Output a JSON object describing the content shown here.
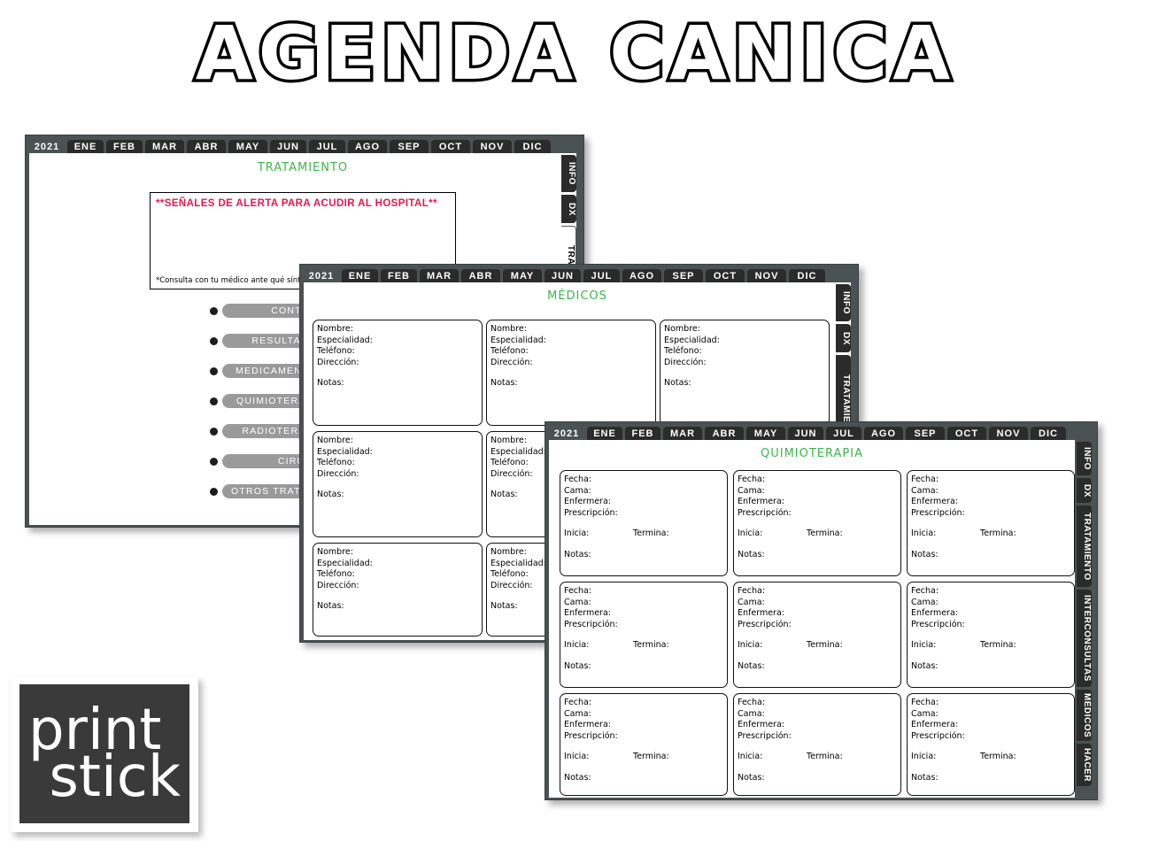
{
  "page": {
    "title": "AGENDA CANICA",
    "background": "#ffffff",
    "accent_green": "#3cb54a",
    "accent_red": "#e8174a",
    "tab_dark": "#2b2b2b",
    "frame_gray": "#4a5253",
    "pill_gray": "#9a9a9a"
  },
  "months": {
    "year": "2021",
    "items": [
      "ENE",
      "FEB",
      "MAR",
      "ABR",
      "MAY",
      "JUN",
      "JUL",
      "AGO",
      "SEP",
      "OCT",
      "NOV",
      "DIC"
    ]
  },
  "card1": {
    "section_title": "TRATAMIENTO",
    "alert": {
      "headline": "**SEÑALES DE ALERTA PARA ACUDIR AL HOSPITAL**",
      "footnote": "*Consulta con tu médico ante qué síntomas debes acudir a urgencias"
    },
    "side_tabs": [
      {
        "label": "INFO",
        "active": false
      },
      {
        "label": "DX",
        "active": false
      },
      {
        "label": "TRATAMIENTO",
        "active": true
      }
    ],
    "pills": [
      "CONTROL",
      "RESULTADOS",
      "MEDICAMENTOS",
      "QUIMIOTERAPIA",
      "RADIOTERAPIA",
      "CIRUGÍA",
      "OTROS TRATAMIENTOS"
    ]
  },
  "card2": {
    "section_title": "MÉDICOS",
    "side_tabs": [
      {
        "label": "INFO",
        "active": false
      },
      {
        "label": "DX",
        "active": false
      },
      {
        "label": "TRATAMIENTO",
        "active": false
      }
    ],
    "doctor_fields": {
      "nombre": "Nombre:",
      "especialidad": "Especialidad:",
      "telefono": "Teléfono:",
      "direccion": "Dirección:",
      "notas": "Notas:"
    },
    "doctor_box_count": 7
  },
  "card3": {
    "section_title": "QUIMIOTERAPIA",
    "side_tabs": [
      {
        "label": "INFO",
        "active": false
      },
      {
        "label": "DX",
        "active": false
      },
      {
        "label": "TRATAMIENTO",
        "active": false
      },
      {
        "label": "INTERCONSULTAS",
        "active": false
      },
      {
        "label": "MÉDICOS",
        "active": false
      },
      {
        "label": "HACER",
        "active": false
      }
    ],
    "chemo_fields": {
      "fecha": "Fecha:",
      "cama": "Cama:",
      "enfermera": "Enfermera:",
      "prescripcion": "Prescripción:",
      "inicia": "Inicia:",
      "termina": "Termina:",
      "notas": "Notas:"
    },
    "chemo_box_count": 9
  },
  "logo": {
    "line1": "print",
    "line2": "stick"
  }
}
